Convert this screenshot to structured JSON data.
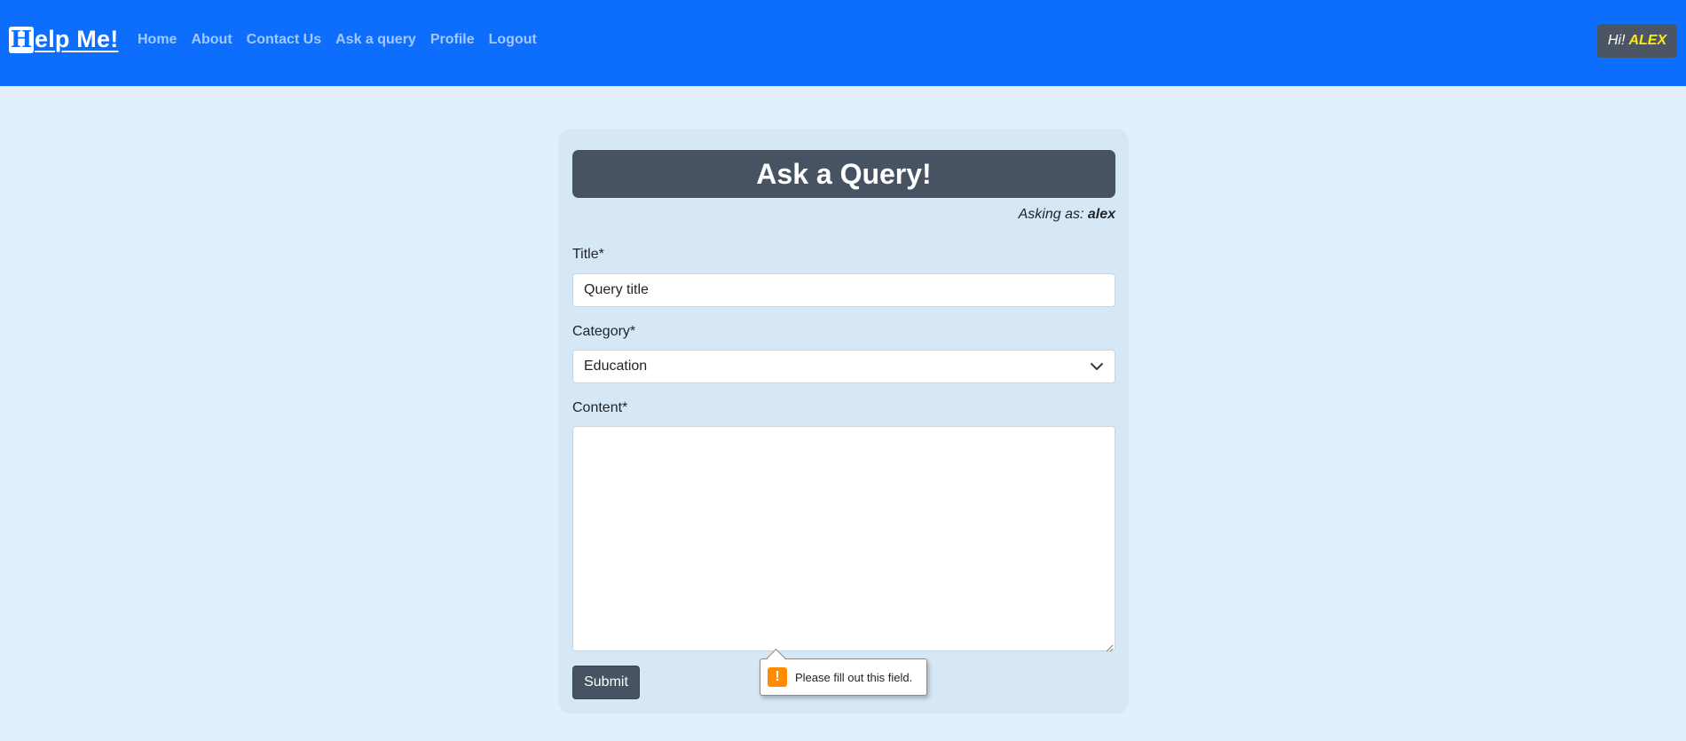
{
  "navbar": {
    "brand_logo_letter": "H",
    "brand_text": "elp Me!",
    "links": [
      {
        "label": "Home"
      },
      {
        "label": "About"
      },
      {
        "label": "Contact Us"
      },
      {
        "label": "Ask a query"
      },
      {
        "label": "Profile"
      },
      {
        "label": "Logout"
      }
    ],
    "greeting": "Hi!",
    "user_name": "ALEX"
  },
  "form": {
    "heading": "Ask a Query!",
    "asking_as_label": "Asking as:",
    "asking_as_user": "alex",
    "title_label": "Title*",
    "title_placeholder": "Query title",
    "title_value": "",
    "category_label": "Category*",
    "category_selected": "Education",
    "content_label": "Content*",
    "content_value": "",
    "submit_label": "Submit"
  },
  "validation": {
    "icon": "warning-icon",
    "icon_glyph": "!",
    "message": "Please fill out this field."
  },
  "colors": {
    "navbar_bg": "#0d6efd",
    "page_bg": "#e2f0fc",
    "card_bg": "#d6e8f6",
    "header_bg": "#475263",
    "user_name_color": "#ffe81a",
    "warning": "#ff8c00"
  }
}
